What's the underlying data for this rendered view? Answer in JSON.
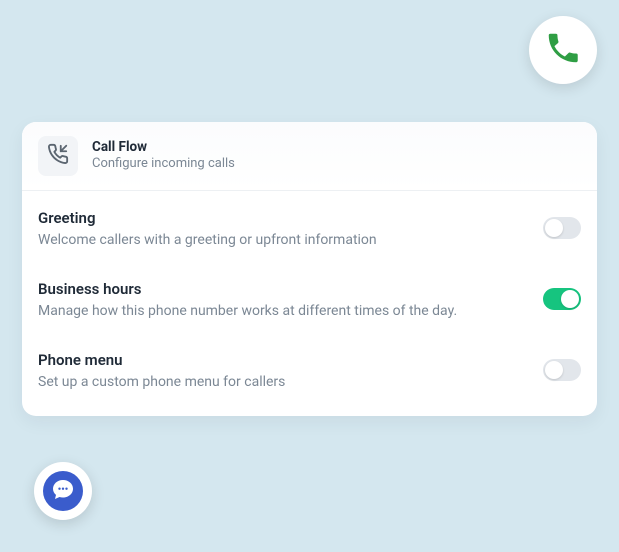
{
  "header": {
    "title": "Call Flow",
    "subtitle": "Configure incoming calls"
  },
  "rows": [
    {
      "label": "Greeting",
      "desc": "Welcome callers with a greeting or upfront information",
      "on": false
    },
    {
      "label": "Business hours",
      "desc": "Manage how this phone number works at different times of the day.",
      "on": true
    },
    {
      "label": "Phone menu",
      "desc": "Set up a custom phone menu for callers",
      "on": false
    }
  ]
}
